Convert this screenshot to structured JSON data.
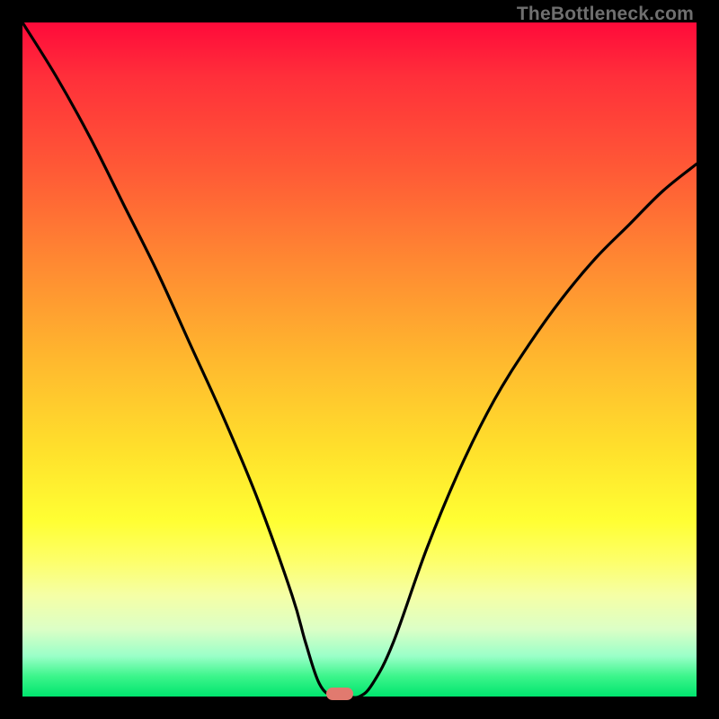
{
  "attribution": "TheBottleneck.com",
  "colors": {
    "gradient_top": "#ff0a3a",
    "gradient_bottom": "#00e56e",
    "curve": "#000000",
    "marker": "#e17a6f",
    "frame": "#000000"
  },
  "chart_data": {
    "type": "line",
    "title": "",
    "xlabel": "",
    "ylabel": "",
    "xlim": [
      0,
      100
    ],
    "ylim": [
      0,
      100
    ],
    "grid": false,
    "legend": false,
    "series": [
      {
        "name": "bottleneck-curve",
        "x": [
          0,
          5,
          10,
          15,
          20,
          25,
          30,
          35,
          40,
          42,
          44,
          46,
          48,
          50,
          52,
          55,
          60,
          65,
          70,
          75,
          80,
          85,
          90,
          95,
          100
        ],
        "y": [
          100,
          92,
          83,
          73,
          63,
          52,
          41,
          29,
          15,
          8,
          2,
          0,
          0,
          0,
          2,
          8,
          22,
          34,
          44,
          52,
          59,
          65,
          70,
          75,
          79
        ]
      }
    ],
    "marker": {
      "x": 47,
      "y": 0
    },
    "background_gradient": {
      "direction": "vertical",
      "stops": [
        {
          "pos": 0.0,
          "color": "#ff0a3a"
        },
        {
          "pos": 0.5,
          "color": "#ffb82e"
        },
        {
          "pos": 0.74,
          "color": "#ffff33"
        },
        {
          "pos": 1.0,
          "color": "#00e56e"
        }
      ]
    }
  }
}
